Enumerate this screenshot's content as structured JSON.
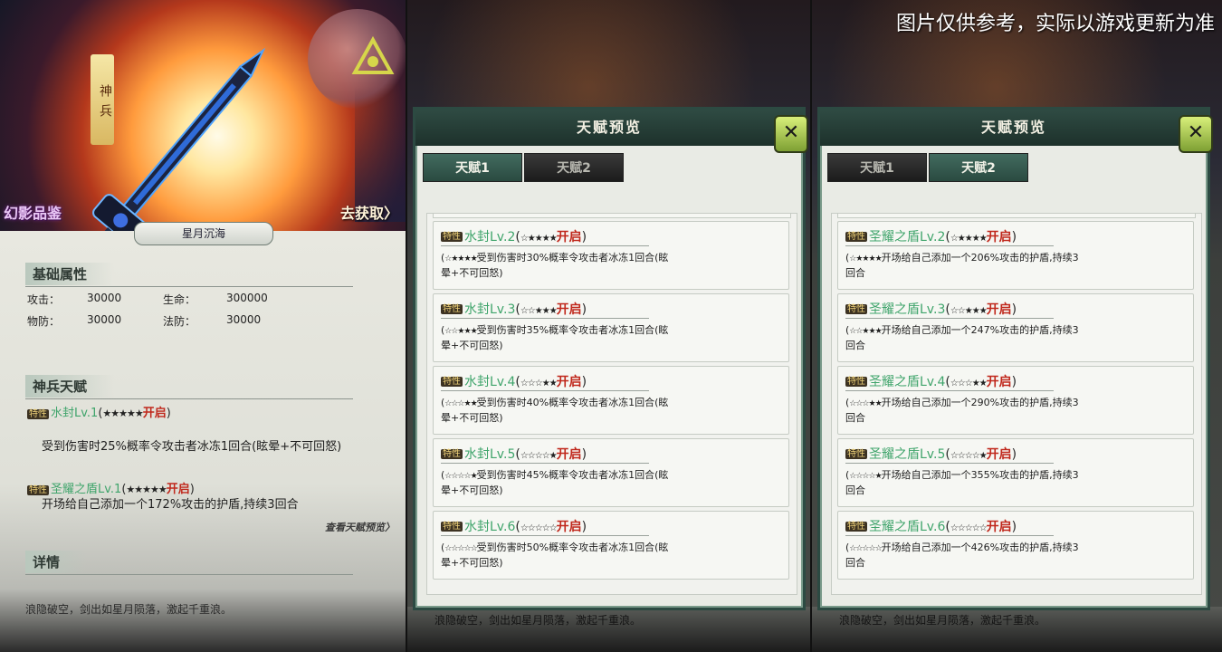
{
  "watermark": "图片仅供参考，实际以游戏更新为准",
  "panel1": {
    "hero": {
      "tag": "神兵",
      "source": "幻影品鉴",
      "go": "去获取〉"
    },
    "weapon_name": "星月沉海",
    "basic": {
      "title": "基础属性",
      "stats": [
        {
          "label": "攻击：",
          "value": "30000"
        },
        {
          "label": "生命：",
          "value": "300000"
        },
        {
          "label": "物防：",
          "value": "30000"
        },
        {
          "label": "法防：",
          "value": "30000"
        }
      ]
    },
    "talent": {
      "title": "神兵天赋",
      "items": [
        {
          "trait": "特性",
          "name": "水封Lv.1",
          "stars": "★★★★★",
          "open": "开启",
          "desc": "受到伤害时25%概率令攻击者冰冻1回合(眩晕+不可回怒)"
        },
        {
          "trait": "特性",
          "name": "圣耀之盾Lv.1",
          "stars": "★★★★★",
          "open": "开启",
          "desc": "开场给自己添加一个172%攻击的护盾,持续3回合"
        }
      ],
      "preview_link": "查看天赋预览〉"
    },
    "detail": {
      "title": "详情",
      "lore": "浪隐破空，剑出如星月陨落，激起千重浪。"
    }
  },
  "popup": {
    "title": "天赋预览",
    "close": "✕",
    "tabs": [
      "天赋1",
      "天赋2"
    ]
  },
  "panel2": {
    "active_tab": 0,
    "cards": [
      {
        "trait": "特性",
        "name": "水封Lv.2",
        "stars": "☆★★★★",
        "open": "开启",
        "dstars": "☆★★★★",
        "desc": "受到伤害时30%概率令攻击者冰冻1回合(眩晕+不可回怒)"
      },
      {
        "trait": "特性",
        "name": "水封Lv.3",
        "stars": "☆☆★★★",
        "open": "开启",
        "dstars": "☆☆★★★",
        "desc": "受到伤害时35%概率令攻击者冰冻1回合(眩晕+不可回怒)"
      },
      {
        "trait": "特性",
        "name": "水封Lv.4",
        "stars": "☆☆☆★★",
        "open": "开启",
        "dstars": "☆☆☆★★",
        "desc": "受到伤害时40%概率令攻击者冰冻1回合(眩晕+不可回怒)"
      },
      {
        "trait": "特性",
        "name": "水封Lv.5",
        "stars": "☆☆☆☆★",
        "open": "开启",
        "dstars": "☆☆☆☆★",
        "desc": "受到伤害时45%概率令攻击者冰冻1回合(眩晕+不可回怒)"
      },
      {
        "trait": "特性",
        "name": "水封Lv.6",
        "stars": "☆☆☆☆☆",
        "open": "开启",
        "dstars": "☆☆☆☆☆",
        "desc": "受到伤害时50%概率令攻击者冰冻1回合(眩晕+不可回怒)"
      }
    ]
  },
  "panel3": {
    "active_tab": 1,
    "cards": [
      {
        "trait": "特性",
        "name": "圣耀之盾Lv.2",
        "stars": "☆★★★★",
        "open": "开启",
        "dstars": "☆★★★★",
        "desc": "开场给自己添加一个206%攻击的护盾,持续3回合"
      },
      {
        "trait": "特性",
        "name": "圣耀之盾Lv.3",
        "stars": "☆☆★★★",
        "open": "开启",
        "dstars": "☆☆★★★",
        "desc": "开场给自己添加一个247%攻击的护盾,持续3回合"
      },
      {
        "trait": "特性",
        "name": "圣耀之盾Lv.4",
        "stars": "☆☆☆★★",
        "open": "开启",
        "dstars": "☆☆☆★★",
        "desc": "开场给自己添加一个290%攻击的护盾,持续3回合"
      },
      {
        "trait": "特性",
        "name": "圣耀之盾Lv.5",
        "stars": "☆☆☆☆★",
        "open": "开启",
        "dstars": "☆☆☆☆★",
        "desc": "开场给自己添加一个355%攻击的护盾,持续3回合"
      },
      {
        "trait": "特性",
        "name": "圣耀之盾Lv.6",
        "stars": "☆☆☆☆☆",
        "open": "开启",
        "dstars": "☆☆☆☆☆",
        "desc": "开场给自己添加一个426%攻击的护盾,持续3回合"
      }
    ]
  }
}
